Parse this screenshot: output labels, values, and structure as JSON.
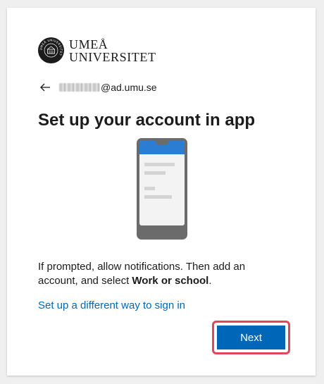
{
  "brand": {
    "line1": "UMEÅ",
    "line2": "UNIVERSITET",
    "seal_text": "UMEÅ UNIVERSITET"
  },
  "identity": {
    "email_suffix": "@ad.umu.se",
    "back_icon": "arrow-left-icon"
  },
  "title": "Set up your account in app",
  "illustration": {
    "icon": "phone-app-illustration",
    "header_color": "#2b7cd3",
    "frame_color": "#6b6b6b"
  },
  "description": {
    "text_before": "If prompted, allow notifications. Then add an account, and select ",
    "bold": "Work or school",
    "text_after": "."
  },
  "link": {
    "label": "Set up a different way to sign in"
  },
  "next_button": {
    "label": "Next"
  },
  "colors": {
    "accent": "#0067b8",
    "highlight_border": "#e0475a"
  }
}
